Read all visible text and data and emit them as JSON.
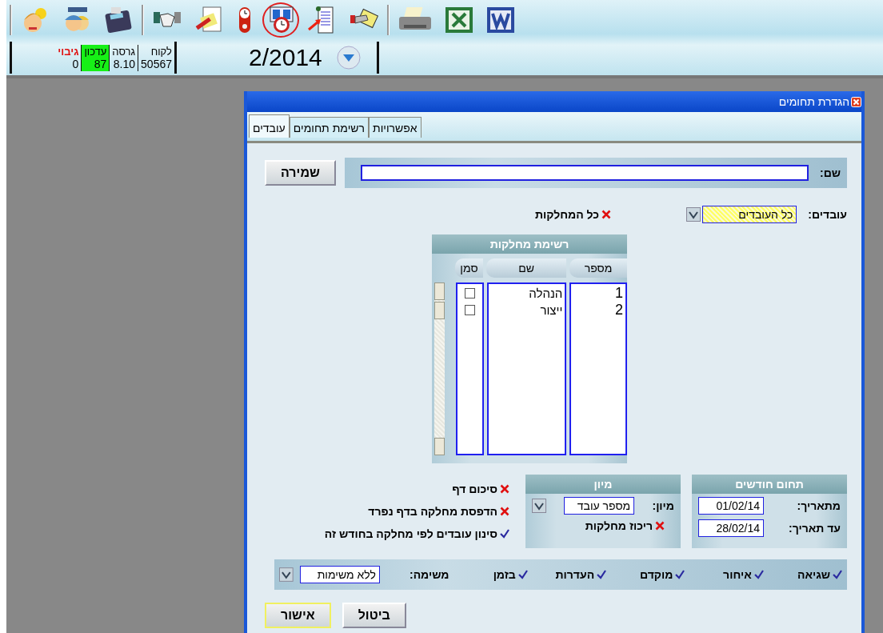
{
  "toolbar": {
    "groups": [
      {
        "icons": [
          {
            "kind": "person-sun",
            "selected": false
          },
          {
            "kind": "people",
            "selected": false
          },
          {
            "kind": "calculator",
            "selected": false
          }
        ]
      },
      {
        "icons": [
          {
            "kind": "handshake",
            "selected": false
          },
          {
            "kind": "document-pen",
            "selected": false
          },
          {
            "kind": "clock",
            "selected": false
          },
          {
            "kind": "calendar-clock",
            "selected": true
          },
          {
            "kind": "scroll-arrow",
            "selected": false
          },
          {
            "kind": "hand-card",
            "selected": false
          }
        ]
      },
      {
        "icons": [
          {
            "kind": "printer",
            "selected": false
          },
          {
            "kind": "spreadsheet",
            "selected": false
          },
          {
            "kind": "document",
            "selected": false
          }
        ]
      }
    ]
  },
  "status_bar": {
    "fields": [
      {
        "label": "לקוח",
        "value": "50567",
        "kind": "plain"
      },
      {
        "label": "גרסה",
        "value": "8.10",
        "kind": "plain"
      },
      {
        "label": "עדכון",
        "value": "87",
        "kind": "highlight"
      },
      {
        "label": "גיבוי",
        "value": "0",
        "kind": "alert"
      }
    ],
    "period": "2/2014"
  },
  "dialog": {
    "title": "הגדרת תחומים",
    "tabs": [
      {
        "label": "אפשרויות",
        "selected": false
      },
      {
        "label": "רשימת תחומים",
        "selected": false
      },
      {
        "label": "עובדים",
        "selected": true
      }
    ],
    "name_label": "שם:",
    "save_button": "שמירה",
    "employees": {
      "label": "עובדים:",
      "value": "כל העובדים"
    },
    "all_departments": {
      "label": "כל המחלקות",
      "checked": false
    },
    "department_list": {
      "title": "רשימת מחלקות",
      "columns": [
        "מספר",
        "שם",
        "סמן"
      ],
      "rows": [
        {
          "number": "1",
          "name": "הנהלה",
          "checked": false
        },
        {
          "number": "2",
          "name": "ייצור",
          "checked": false
        }
      ]
    },
    "month_range": {
      "title": "תחום חודשים",
      "from_label": "מתאריך:",
      "from": "01/02/14",
      "to_label": "עד תאריך:",
      "to": "28/02/14"
    },
    "sort": {
      "title": "מיון",
      "label": "מיון:",
      "value": "מספר עובד",
      "group_label": "ריכוז מחלקות",
      "group_checked": false
    },
    "options": [
      {
        "label": "סיכום דף",
        "checked": false
      },
      {
        "label": "הדפסת מחלקה בדף נפרד",
        "checked": false
      },
      {
        "label": "סינון עובדים לפי מחלקה בחודש זה",
        "checked": true
      }
    ],
    "filters": [
      {
        "label": "שגיאה",
        "checked": true
      },
      {
        "label": "איחור",
        "checked": true
      },
      {
        "label": "מוקדם",
        "checked": true
      },
      {
        "label": "העדרות",
        "checked": true
      },
      {
        "label": "בזמן",
        "checked": true
      }
    ],
    "task": {
      "label": "משימה:",
      "value": "ללא משימות"
    },
    "buttons": [
      {
        "label": "ביטול",
        "kind": "normal"
      },
      {
        "label": "אישור",
        "kind": "default"
      }
    ]
  }
}
